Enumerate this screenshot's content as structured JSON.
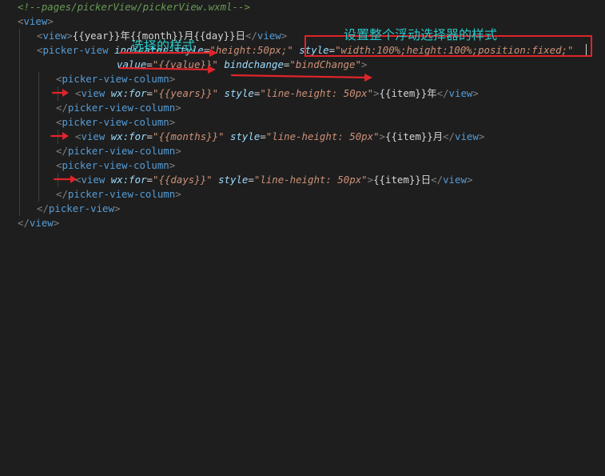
{
  "colors": {
    "background": "#1e1e1e",
    "comment": "#6a9955",
    "tag": "#569cd6",
    "attribute": "#9cdcfe",
    "string": "#ce9178",
    "text": "#d4d4d4",
    "annotation": "#29c7c7",
    "markup_red": "#e0242b"
  },
  "code": {
    "line1": {
      "comment": "<!--pages/pickerView/pickerView.wxml-->"
    },
    "line2": {
      "open": "<",
      "tag": "view",
      "close": ">"
    },
    "line3": {
      "open": "<",
      "tag": "view",
      "close1": ">",
      "text": "{{year}}年{{month}}月{{day}}日",
      "end_open": "</",
      "end_tag": "view",
      "end_close": ">"
    },
    "line4": {
      "open": "<",
      "tag": "picker-view",
      "attr1": "indicator-style",
      "eq1": "=",
      "val1": "\"height:50px;\"",
      "attr2": "style",
      "eq2": "=",
      "val2": "\"width:100%;height:100%;position:fixed;\""
    },
    "line5": {
      "attr1": "value",
      "eq1": "=",
      "val1": "\"{{value}}\"",
      "attr2": "bindchange",
      "eq2": "=",
      "val2": "\"bindChange\"",
      "close": ">"
    },
    "line6": {
      "open": "<",
      "tag": "picker-view-column",
      "close": ">"
    },
    "line7": {
      "open": "<",
      "tag": "view",
      "attr1": "wx:for",
      "eq1": "=",
      "val1": "\"{{years}}\"",
      "attr2": "style",
      "eq2": "=",
      "val2": "\"line-height: 50px\"",
      "close1": ">",
      "text": "{{item}}年",
      "end_open": "</",
      "end_tag": "view",
      "end_close": ">"
    },
    "line8": {
      "open": "</",
      "tag": "picker-view-column",
      "close": ">"
    },
    "line9": {
      "open": "<",
      "tag": "picker-view-column",
      "close": ">"
    },
    "line10": {
      "open": "<",
      "tag": "view",
      "attr1": "wx:for",
      "eq1": "=",
      "val1": "\"{{months}}\"",
      "attr2": "style",
      "eq2": "=",
      "val2": "\"line-height: 50px\"",
      "close1": ">",
      "text": "{{item}}月",
      "end_open": "</",
      "end_tag": "view",
      "end_close": ">"
    },
    "line11": {
      "open": "</",
      "tag": "picker-view-column",
      "close": ">"
    },
    "line12": {
      "open": "<",
      "tag": "picker-view-column",
      "close": ">"
    },
    "line13": {
      "open": "<",
      "tag": "view",
      "attr1": "wx:for",
      "eq1": "=",
      "val1": "\"{{days}}\"",
      "attr2": "style",
      "eq2": "=",
      "val2": "\"line-height: 50px\"",
      "close1": ">",
      "text": "{{item}}日",
      "end_open": "</",
      "end_tag": "view",
      "end_close": ">"
    },
    "line14": {
      "open": "</",
      "tag": "picker-view-column",
      "close": ">"
    },
    "line15": {
      "open": "</",
      "tag": "picker-view",
      "close": ">"
    },
    "line16": {
      "open": "</",
      "tag": "view",
      "close": ">"
    }
  },
  "annotations": {
    "style_whole_picker": "设置整个浮动选择器的样式",
    "selection_style": "选择的样式"
  }
}
